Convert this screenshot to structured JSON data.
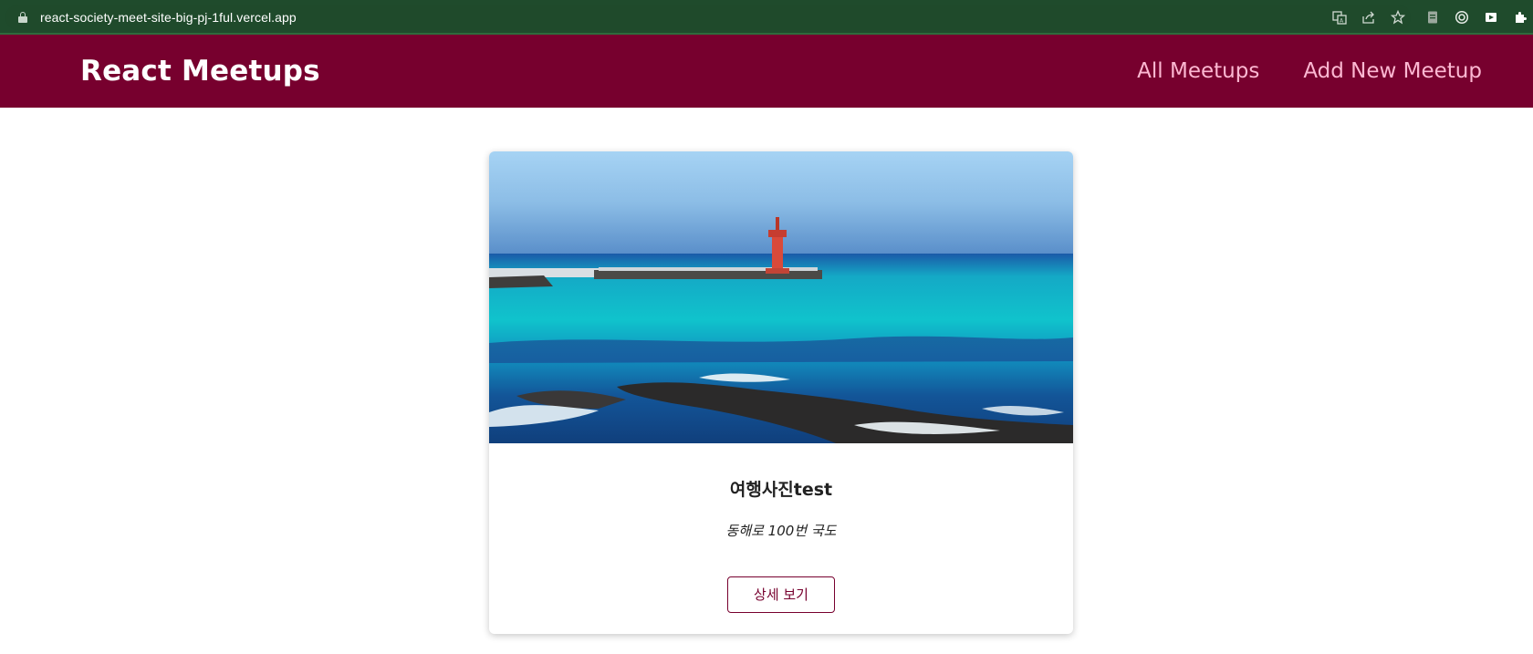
{
  "browser": {
    "url": "react-society-meet-site-big-pj-1ful.vercel.app",
    "icons": [
      "translate-icon",
      "share-icon",
      "bookmark-star-icon",
      "extension-doc-icon",
      "extension-target-icon",
      "extension-media-icon",
      "extensions-puzzle-icon"
    ]
  },
  "header": {
    "logo": "React Meetups",
    "nav": [
      {
        "label": "All Meetups"
      },
      {
        "label": "Add New Meetup"
      }
    ]
  },
  "meetups": [
    {
      "image_alt": "Coastal view with red lighthouse and turquoise sea",
      "title": "여행사진test",
      "address": "동해로 100번 국도",
      "button_label": "상세 보기"
    }
  ],
  "colors": {
    "header_bg": "#77002e",
    "nav_link": "#fcb8d2",
    "browser_bar": "#1f4b2c",
    "button_accent": "#77002e"
  }
}
